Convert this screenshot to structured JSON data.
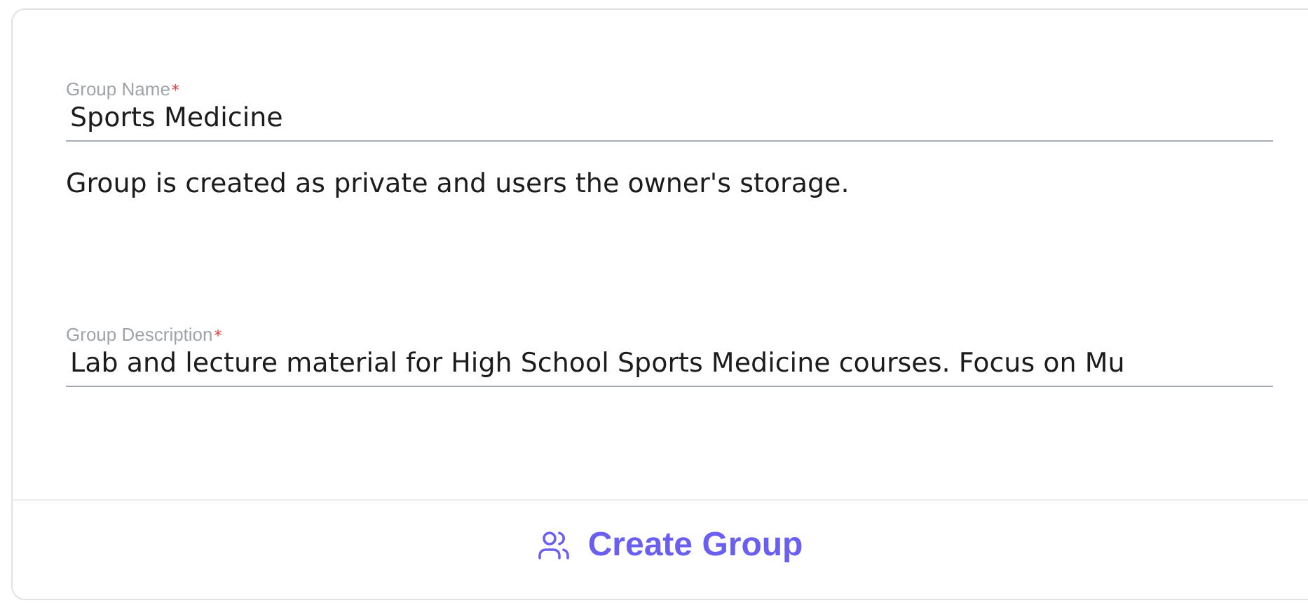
{
  "fields": [
    {
      "label": "Group Name",
      "required_mark": "*",
      "value": "Sports Medicine",
      "note": "Group is created as private and users the owner's storage."
    },
    {
      "label": "Group Description",
      "required_mark": "*",
      "value": "Lab and lecture material for High School Sports Medicine courses. Focus on Mu"
    }
  ],
  "action": {
    "label": "Create Group"
  }
}
